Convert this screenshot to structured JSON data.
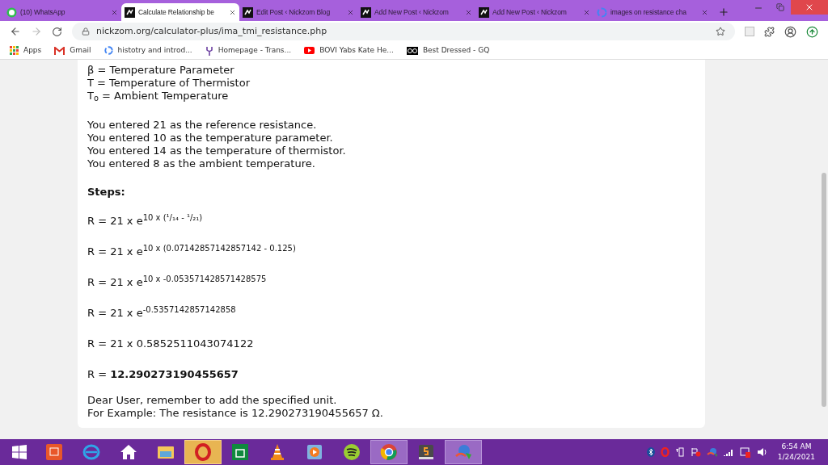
{
  "tabs": [
    {
      "title": "(10) WhatsApp",
      "selected": false
    },
    {
      "title": "Calculate Relationship be",
      "selected": true
    },
    {
      "title": "Edit Post ‹ Nickzom Blog",
      "selected": false
    },
    {
      "title": "Add New Post ‹ Nickzom",
      "selected": false
    },
    {
      "title": "Add New Post ‹ Nickzom",
      "selected": false
    },
    {
      "title": "images on resistance cha",
      "selected": false
    }
  ],
  "address_bar": {
    "url": "nickzom.org/calculator-plus/ima_tmi_resistance.php"
  },
  "bookmarks": [
    {
      "label": "Apps"
    },
    {
      "label": "Gmail"
    },
    {
      "label": "histotry and introd..."
    },
    {
      "label": "Homepage - Trans..."
    },
    {
      "label": "BOVI Yabs Kate He..."
    },
    {
      "label": "Best Dressed - GQ"
    }
  ],
  "page": {
    "definitions": [
      "β = Temperature Parameter",
      "T = Temperature of Thermistor",
      "T$_{o}$ = Ambient Temperature"
    ],
    "entries": [
      "You entered 21 as the reference resistance.",
      "You entered 10 as the temperature parameter.",
      "You entered 14 as the temperature of thermistor.",
      "You entered 8 as the ambient temperature."
    ],
    "steps_heading": "Steps:",
    "steps": [
      "R = 21 x e$^{10 x (¹/₁₄ - ¹/₂₁)}$",
      "R = 21 x e$^{10 x (0.07142857142857142 - 0.125)}$",
      "R = 21 x e$^{10 x -0.053571428571428575}$",
      "R = 21 x e$^{-0.5357142857142858}$",
      "R = 21 x 0.5852511043074122",
      "R = **12.290273190455657**"
    ],
    "notes": [
      "Dear User, remember to add the specified unit.",
      "For Example: The resistance is 12.290273190455657 Ω."
    ]
  },
  "taskbar": {
    "items": [
      {
        "open": false
      },
      {
        "open": false
      },
      {
        "open": false
      },
      {
        "open": false
      },
      {
        "open": true
      },
      {
        "open": false
      },
      {
        "open": false
      },
      {
        "open": false
      },
      {
        "open": false
      },
      {
        "open": true
      },
      {
        "open": false
      },
      {
        "open": true
      }
    ],
    "time": "6:54 AM",
    "date": "1/24/2021"
  }
}
